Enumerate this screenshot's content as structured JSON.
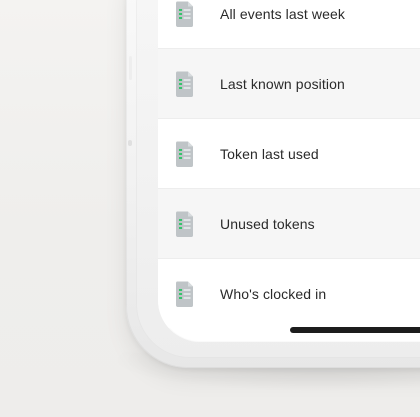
{
  "list": {
    "items": [
      {
        "label": "All events last week",
        "icon": "document-icon"
      },
      {
        "label": "Last known position",
        "icon": "document-icon"
      },
      {
        "label": "Token last used",
        "icon": "document-icon"
      },
      {
        "label": "Unused tokens",
        "icon": "document-icon"
      },
      {
        "label": "Who's clocked in",
        "icon": "document-icon"
      }
    ]
  },
  "colors": {
    "row_alt_bg": "#f6f6f6",
    "row_bg": "#ffffff",
    "text": "#2a2a2a",
    "icon_doc": "#bfc4c7",
    "icon_accent": "#35c36b",
    "home_indicator": "#111111"
  }
}
